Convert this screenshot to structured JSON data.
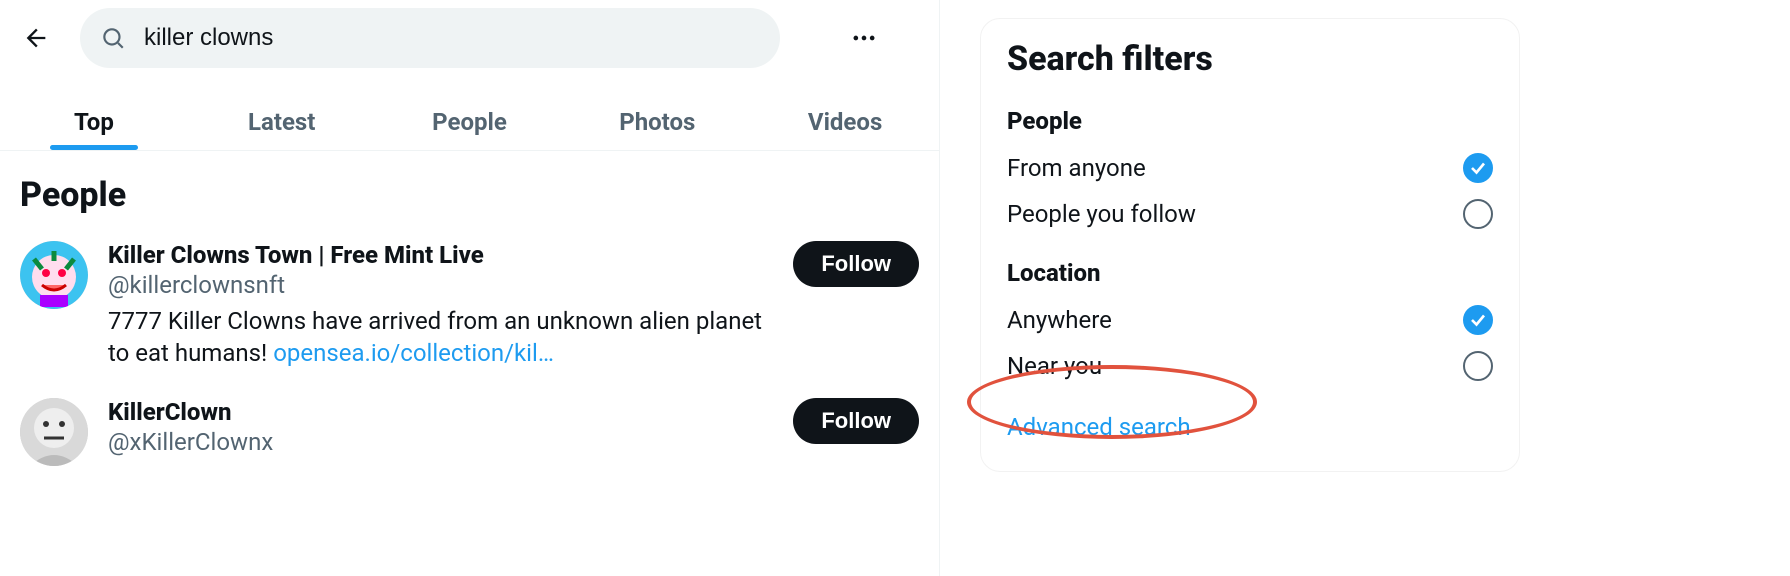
{
  "search": {
    "query": "killer clowns"
  },
  "tabs": [
    {
      "label": "Top",
      "active": true
    },
    {
      "label": "Latest",
      "active": false
    },
    {
      "label": "People",
      "active": false
    },
    {
      "label": "Photos",
      "active": false
    },
    {
      "label": "Videos",
      "active": false
    }
  ],
  "section": {
    "title": "People"
  },
  "people": [
    {
      "name": "Killer Clowns Town | Free Mint Live",
      "handle": "@killerclownsnft",
      "bio_text": "7777 Killer Clowns have arrived from an unknown alien planet to eat humans! ",
      "bio_link": "opensea.io/collection/kil…",
      "follow_label": "Follow"
    },
    {
      "name": "KillerClown",
      "handle": "@xKillerClownx",
      "bio_text": "",
      "bio_link": "",
      "follow_label": "Follow"
    }
  ],
  "filters": {
    "title": "Search filters",
    "groups": [
      {
        "label": "People",
        "options": [
          {
            "label": "From anyone",
            "checked": true
          },
          {
            "label": "People you follow",
            "checked": false
          }
        ]
      },
      {
        "label": "Location",
        "options": [
          {
            "label": "Anywhere",
            "checked": true
          },
          {
            "label": "Near you",
            "checked": false
          }
        ]
      }
    ],
    "advanced_label": "Advanced search"
  }
}
